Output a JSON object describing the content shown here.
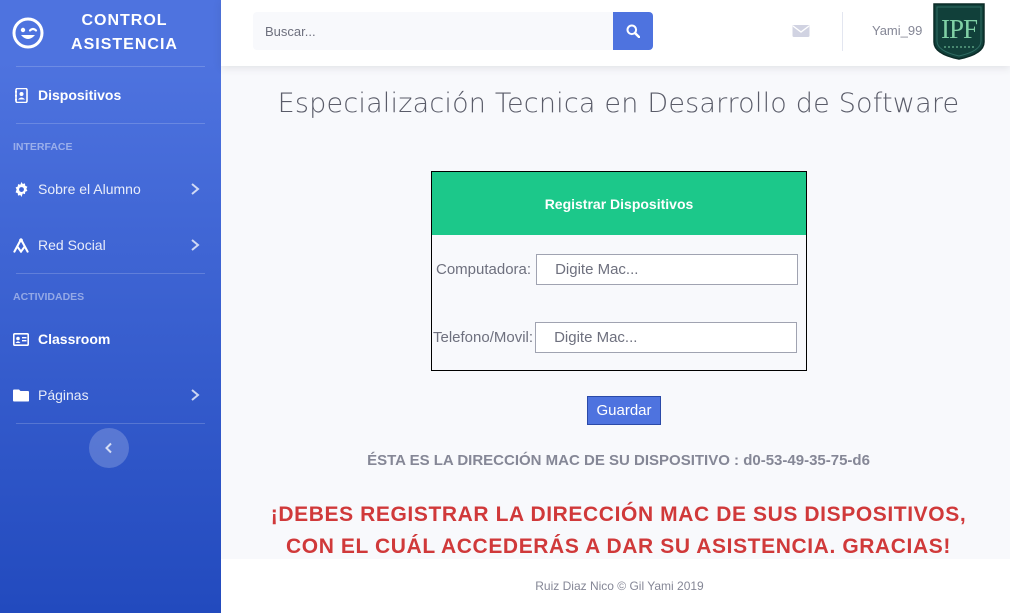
{
  "sidebar": {
    "brand_line1": "CONTROL",
    "brand_line2": "ASISTENCIA",
    "items": [
      {
        "label": "Dispositivos"
      },
      {
        "heading": "INTERFACE"
      },
      {
        "label": "Sobre el Alumno"
      },
      {
        "label": "Red Social"
      },
      {
        "heading": "ACTIVIDADES"
      },
      {
        "label": "Classroom"
      },
      {
        "label": "Páginas"
      }
    ]
  },
  "topbar": {
    "search_placeholder": "Buscar...",
    "username": "Yami_99",
    "avatar_text": "IPF"
  },
  "main": {
    "title": "Especialización Tecnica en Desarrollo de Software",
    "card_title": "Registrar Dispositivos",
    "computer_label": "Computadora:",
    "computer_placeholder": "Digite Mac...",
    "phone_label": "Telefono/Movil:",
    "phone_placeholder": "Digite Mac...",
    "save_label": "Guardar",
    "mac_info": "ÉSTA ES LA DIRECCIÓN MAC DE SU DISPOSITIVO : d0-53-49-35-75-d6",
    "warning_line1": "¡DEBES REGISTRAR LA DIRECCIÓN MAC DE SUS DISPOSITIVOS,",
    "warning_line2": "CON EL CUÁL ACCEDERÁS A DAR SU ASISTENCIA. GRACIAS!"
  },
  "footer": {
    "text": "Ruiz Diaz Nico © Gil Yami 2019"
  },
  "colors": {
    "sidebar_top": "#4e73df",
    "sidebar_bottom": "#224abe",
    "card_header": "#1cc88a",
    "primary": "#4e73df",
    "warning_text": "#d0393a"
  },
  "icons": {
    "brand": "laugh-wink-icon",
    "dispositivos": "address-book-icon",
    "sobre_alumno": "gear-icon",
    "red_social": "network-icon",
    "classroom": "id-card-icon",
    "paginas": "folder-icon",
    "search": "search-icon",
    "mail": "envelope-icon",
    "toggle": "chevron-left-icon"
  }
}
